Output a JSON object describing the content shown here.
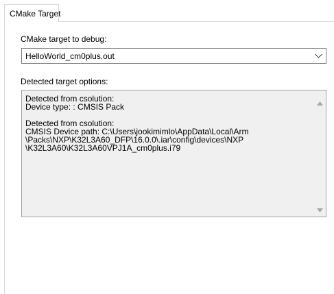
{
  "tab": {
    "label": "CMake Target"
  },
  "target": {
    "label": "CMake target to debug:",
    "selected_value": "HelloWorld_cm0plus.out",
    "arrow_icon": "chevron-down-icon"
  },
  "detected": {
    "label": "Detected target options:",
    "lines": [
      "Detected from csolution:",
      "Device type: : CMSIS Pack",
      "",
      "Detected from csolution:",
      "CMSIS Device path: C:\\Users\\jookimimlo\\AppData\\Local\\Arm",
      "\\Packs\\NXP\\K32L3A60_DFP\\16.0.0\\.iar\\config\\devices\\NXP",
      "\\K32L3A60\\K32L3A60VPJ1A_cm0plus.i79"
    ]
  },
  "colors": {
    "border": "#d9d9d9",
    "combo_border": "#7a7a7a",
    "textbox_bg": "#f0f0f0",
    "scroll_arrow": "#a6a6a6"
  }
}
